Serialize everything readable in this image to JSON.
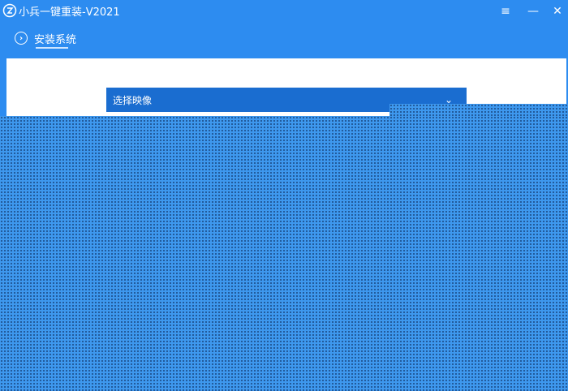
{
  "window": {
    "title": "小兵一键重装-V2021",
    "menu_icon": "≡",
    "minimize_icon": "—",
    "close_icon": "✕"
  },
  "tabs": [
    {
      "label": "安装系统",
      "icon": "chevron-right-circle-icon"
    }
  ],
  "dialog": {
    "title": "选择映像",
    "chevron": "⌄"
  },
  "colors": {
    "titlebar": "#2d8cf0",
    "dialog_header": "#1a6dd0",
    "overlay": "#3e98ee"
  }
}
